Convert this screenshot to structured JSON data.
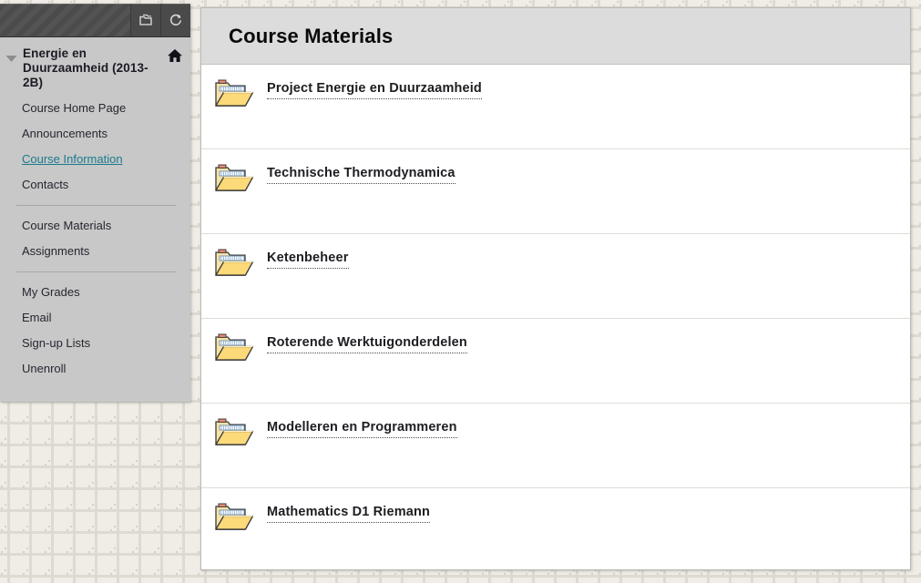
{
  "colors": {
    "page_background": "#efede6",
    "menu_background": "#c8c8c8",
    "menu_header_dark": "#4b4b4b",
    "content_header": "#dcdcdc",
    "panel_white": "#ffffff",
    "active_link": "#1a7a8c",
    "folder_body": "#fbd87a",
    "folder_paper": "#ffffff"
  },
  "course_menu": {
    "header": {
      "collapse_icon": "folder-collapse-icon",
      "refresh_icon": "refresh-icon"
    },
    "expand_icon": "triangle-down-icon",
    "home_icon": "home-icon",
    "course_title": "Energie en Duurzaamheid (2013-2B)",
    "groups": [
      {
        "items": [
          {
            "label": "Course Home Page",
            "active": false
          },
          {
            "label": "Announcements",
            "active": false
          },
          {
            "label": "Course Information",
            "active": true
          },
          {
            "label": "Contacts",
            "active": false
          }
        ]
      },
      {
        "items": [
          {
            "label": "Course Materials",
            "active": false
          },
          {
            "label": "Assignments",
            "active": false
          }
        ]
      },
      {
        "items": [
          {
            "label": "My Grades",
            "active": false
          },
          {
            "label": "Email",
            "active": false
          },
          {
            "label": "Sign-up Lists",
            "active": false
          },
          {
            "label": "Unenroll",
            "active": false
          }
        ]
      }
    ]
  },
  "content": {
    "title": "Course Materials",
    "items": [
      {
        "label": "Project Energie en Duurzaamheid",
        "icon": "folder-icon"
      },
      {
        "label": "Technische Thermodynamica",
        "icon": "folder-icon"
      },
      {
        "label": "Ketenbeheer",
        "icon": "folder-icon"
      },
      {
        "label": "Roterende Werktuigonderdelen",
        "icon": "folder-icon"
      },
      {
        "label": "Modelleren en Programmeren",
        "icon": "folder-icon"
      },
      {
        "label": "Mathematics D1 Riemann",
        "icon": "folder-icon"
      }
    ]
  }
}
